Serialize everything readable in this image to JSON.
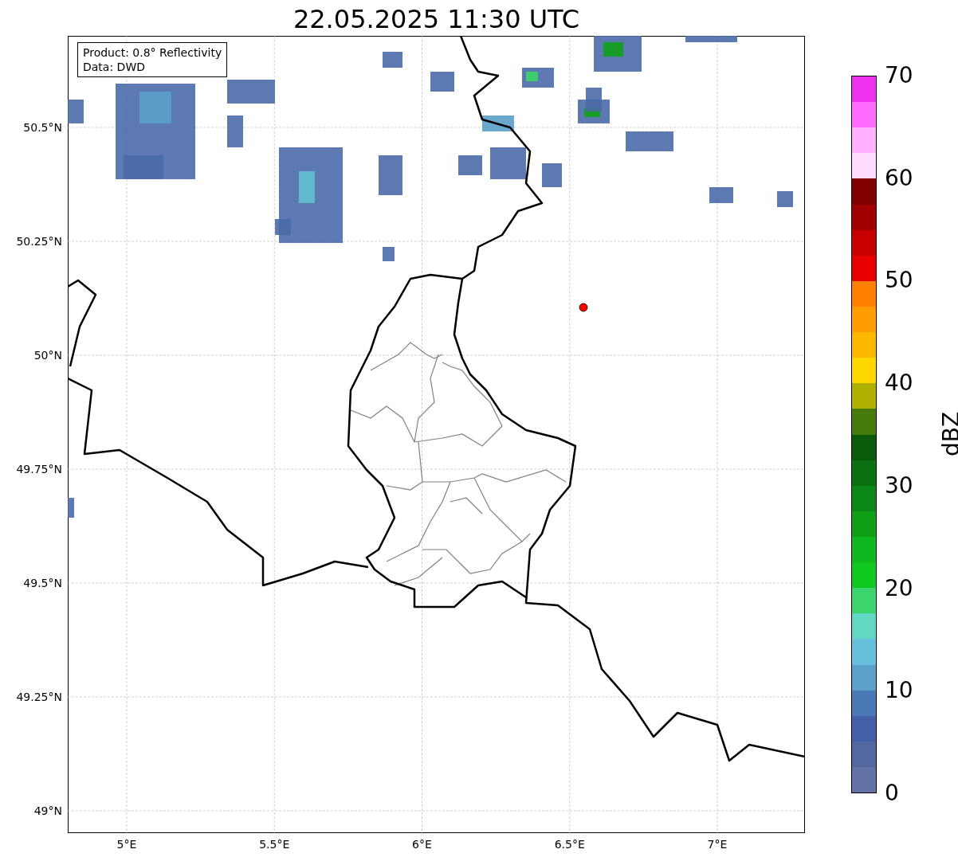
{
  "title": "22.05.2025 11:30 UTC",
  "legend": {
    "lines": [
      "Product: 0.8° Reflectivity",
      "Data: DWD"
    ]
  },
  "map": {
    "yticks": [
      "50.5°N",
      "50.25°N",
      "50°N",
      "49.75°N",
      "49.5°N",
      "49.25°N",
      "49°N"
    ],
    "xticks": [
      "5°E",
      "5.5°E",
      "6°E",
      "6.5°E",
      "7°E"
    ],
    "marker": {
      "color": "#ff0000"
    }
  },
  "colorbar": {
    "label": "dBZ",
    "ticks": [
      "70",
      "60",
      "50",
      "40",
      "30",
      "20",
      "10",
      "0"
    ],
    "segments": [
      {
        "color": "#ee33ee"
      },
      {
        "color": "#ff6cff"
      },
      {
        "color": "#ffb0ff"
      },
      {
        "color": "#ffdcff"
      },
      {
        "color": "#800000"
      },
      {
        "color": "#a00000"
      },
      {
        "color": "#c80000"
      },
      {
        "color": "#e80000"
      },
      {
        "color": "#ff8000"
      },
      {
        "color": "#ff9c00"
      },
      {
        "color": "#ffb800"
      },
      {
        "color": "#ffd800"
      },
      {
        "color": "#b0b000"
      },
      {
        "color": "#467a0a"
      },
      {
        "color": "#0a5a0c"
      },
      {
        "color": "#0a7010"
      },
      {
        "color": "#0c8818"
      },
      {
        "color": "#10a018"
      },
      {
        "color": "#10b820"
      },
      {
        "color": "#10c820"
      },
      {
        "color": "#3cd46c"
      },
      {
        "color": "#60d8c4"
      },
      {
        "color": "#66c0dc"
      },
      {
        "color": "#5aa0c8"
      },
      {
        "color": "#4a7ab5"
      },
      {
        "color": "#4460a8"
      },
      {
        "color": "#5468a0"
      },
      {
        "color": "#6472a8"
      }
    ]
  }
}
